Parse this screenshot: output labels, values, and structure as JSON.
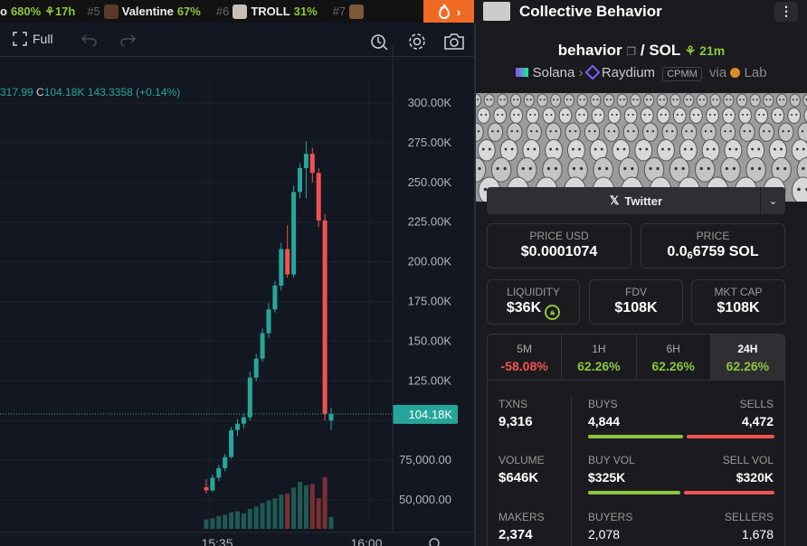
{
  "ticker": {
    "items": [
      {
        "rank": "",
        "name": "o",
        "pct": "680%",
        "time": "17h"
      },
      {
        "rank": "#5",
        "name": "Valentine",
        "pct": "67%",
        "time": ""
      },
      {
        "rank": "#6",
        "name": "TROLL",
        "pct": "31%",
        "time": ""
      },
      {
        "rank": "#7",
        "name": "",
        "pct": "",
        "time": ""
      }
    ],
    "fire_chevron": "›"
  },
  "toolbar": {
    "fullscreen_label": "Full"
  },
  "chart_ohlc": {
    "close_partial": "317.99",
    "c_label": "C",
    "c_value": "104.18K",
    "change": "143.3358 (+0.14%)"
  },
  "chart_data": {
    "type": "candlestick",
    "price_ticks": [
      "300.00K",
      "275.00K",
      "250.00K",
      "225.00K",
      "200.00K",
      "175.00K",
      "150.00K",
      "125.00K",
      "100.00K",
      "75,000.00",
      "50,000.00"
    ],
    "tick_values": [
      300000,
      275000,
      250000,
      225000,
      200000,
      175000,
      150000,
      125000,
      100000,
      75000,
      50000
    ],
    "time_ticks": [
      "15:35",
      "16:00"
    ],
    "current_price_label": "104.18K",
    "current_price": 104180,
    "candles": [
      {
        "o": 58000,
        "h": 63000,
        "l": 54000,
        "c": 56000
      },
      {
        "o": 56000,
        "h": 66000,
        "l": 55000,
        "c": 64000
      },
      {
        "o": 64000,
        "h": 72000,
        "l": 62000,
        "c": 70000
      },
      {
        "o": 70000,
        "h": 79000,
        "l": 68000,
        "c": 77000
      },
      {
        "o": 77000,
        "h": 96000,
        "l": 76000,
        "c": 94000
      },
      {
        "o": 94000,
        "h": 101000,
        "l": 90000,
        "c": 98000
      },
      {
        "o": 98000,
        "h": 104000,
        "l": 95000,
        "c": 102000
      },
      {
        "o": 102000,
        "h": 131000,
        "l": 100000,
        "c": 127000
      },
      {
        "o": 127000,
        "h": 142000,
        "l": 125000,
        "c": 139000
      },
      {
        "o": 139000,
        "h": 158000,
        "l": 137000,
        "c": 155000
      },
      {
        "o": 155000,
        "h": 174000,
        "l": 152000,
        "c": 170000
      },
      {
        "o": 170000,
        "h": 188000,
        "l": 168000,
        "c": 185000
      },
      {
        "o": 185000,
        "h": 212000,
        "l": 182000,
        "c": 208000
      },
      {
        "o": 208000,
        "h": 223000,
        "l": 190000,
        "c": 192000
      },
      {
        "o": 192000,
        "h": 248000,
        "l": 190000,
        "c": 244000
      },
      {
        "o": 244000,
        "h": 262000,
        "l": 240000,
        "c": 259000
      },
      {
        "o": 259000,
        "h": 276000,
        "l": 240000,
        "c": 268000
      },
      {
        "o": 268000,
        "h": 272000,
        "l": 250000,
        "c": 256000
      },
      {
        "o": 256000,
        "h": 259000,
        "l": 222000,
        "c": 226000
      },
      {
        "o": 226000,
        "h": 230000,
        "l": 100000,
        "c": 104000
      },
      {
        "o": 100000,
        "h": 108000,
        "l": 94000,
        "c": 104180
      }
    ],
    "volumes": [
      8,
      9,
      11,
      12,
      14,
      15,
      13,
      17,
      19,
      22,
      24,
      26,
      29,
      30,
      35,
      40,
      37,
      38,
      26,
      44,
      10
    ],
    "volume_colors": [
      "up",
      "up",
      "up",
      "up",
      "up",
      "up",
      "up",
      "up",
      "up",
      "up",
      "up",
      "up",
      "up",
      "down",
      "up",
      "up",
      "up",
      "down",
      "down",
      "down",
      "up"
    ],
    "up_color": "#26a69a",
    "down_color": "#ef5350"
  },
  "panel": {
    "title": "Collective Behavior",
    "pair_base": "behavior",
    "pair_sep": "/",
    "pair_quote": "SOL",
    "age": "21m",
    "chain": "Solana",
    "dex": "Raydium",
    "pool_type": "CPMM",
    "via": "via",
    "via_source": "Lab",
    "twitter_label": "Twitter",
    "price_usd_label": "PRICE USD",
    "price_usd": "$0.0001074",
    "price_label": "PRICE",
    "price_prefix": "0.0",
    "price_zero_count": "6",
    "price_suffix": "6759 SOL",
    "liquidity_label": "LIQUIDITY",
    "liquidity": "$36K",
    "fdv_label": "FDV",
    "fdv": "$108K",
    "mcap_label": "MKT CAP",
    "mcap": "$108K",
    "timeframes": [
      {
        "label": "5M",
        "value": "-58.08%",
        "color": "#f05350"
      },
      {
        "label": "1H",
        "value": "62.26%",
        "color": "#8dc63f"
      },
      {
        "label": "6H",
        "value": "62.26%",
        "color": "#8dc63f"
      },
      {
        "label": "24H",
        "value": "62.26%",
        "color": "#8dc63f"
      }
    ],
    "txns_label": "TXNS",
    "txns": "9,316",
    "buys_label": "BUYS",
    "buys": "4,844",
    "sells_label": "SELLS",
    "sells": "4,472",
    "volume_label": "VOLUME",
    "volume": "$646K",
    "buy_vol_label": "BUY VOL",
    "buy_vol": "$325K",
    "sell_vol_label": "SELL VOL",
    "sell_vol": "$320K",
    "makers_label": "MAKERS",
    "makers": "2,374",
    "buyers_label": "BUYERS",
    "buyers": "2,078",
    "sellers_label": "SELLERS",
    "sellers": "1,678",
    "buy_share": 0.52,
    "buyvol_share": 0.504
  }
}
